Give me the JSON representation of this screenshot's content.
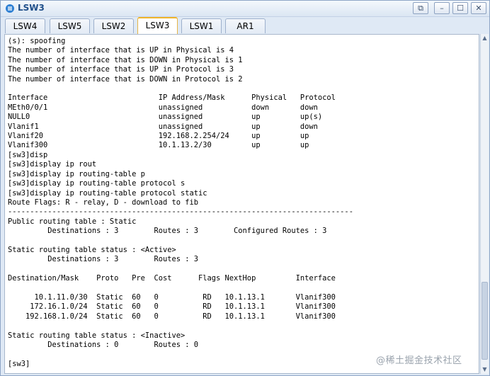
{
  "window": {
    "title": "LSW3",
    "icon": "ensp-device-icon",
    "controls": {
      "restore_other": "⧉",
      "minimize": "–",
      "maximize": "☐",
      "close": "✕"
    }
  },
  "tabs": [
    {
      "label": "LSW4",
      "active": false
    },
    {
      "label": "LSW5",
      "active": false
    },
    {
      "label": "LSW2",
      "active": false
    },
    {
      "label": "LSW3",
      "active": true
    },
    {
      "label": "LSW1",
      "active": false
    },
    {
      "label": "AR1",
      "active": false
    }
  ],
  "terminal": {
    "lines": [
      "(s): spoofing",
      "The number of interface that is UP in Physical is 4",
      "The number of interface that is DOWN in Physical is 1",
      "The number of interface that is UP in Protocol is 3",
      "The number of interface that is DOWN in Protocol is 2",
      "",
      "Interface                         IP Address/Mask      Physical   Protocol",
      "MEth0/0/1                         unassigned           down       down",
      "NULL0                             unassigned           up         up(s)",
      "Vlanif1                           unassigned           up         down",
      "Vlanif20                          192.168.2.254/24     up         up",
      "Vlanif300                         10.1.13.2/30         up         up",
      "[sw3]disp",
      "[sw3]display ip rout",
      "[sw3]display ip routing-table p",
      "[sw3]display ip routing-table protocol s",
      "[sw3]display ip routing-table protocol static",
      "Route Flags: R - relay, D - download to fib",
      "------------------------------------------------------------------------------",
      "Public routing table : Static",
      "         Destinations : 3        Routes : 3        Configured Routes : 3",
      "",
      "Static routing table status : <Active>",
      "         Destinations : 3        Routes : 3",
      "",
      "Destination/Mask    Proto   Pre  Cost      Flags NextHop         Interface",
      "",
      "      10.1.11.0/30  Static  60   0          RD   10.1.13.1       Vlanif300",
      "     172.16.1.0/24  Static  60   0          RD   10.1.13.1       Vlanif300",
      "    192.168.1.0/24  Static  60   0          RD   10.1.13.1       Vlanif300",
      "",
      "Static routing table status : <Inactive>",
      "         Destinations : 0        Routes : 0",
      "",
      "[sw3]"
    ]
  },
  "scrollbar": {
    "up_arrow": "▲",
    "down_arrow": "▼"
  },
  "watermark": "@稀土掘金技术社区"
}
